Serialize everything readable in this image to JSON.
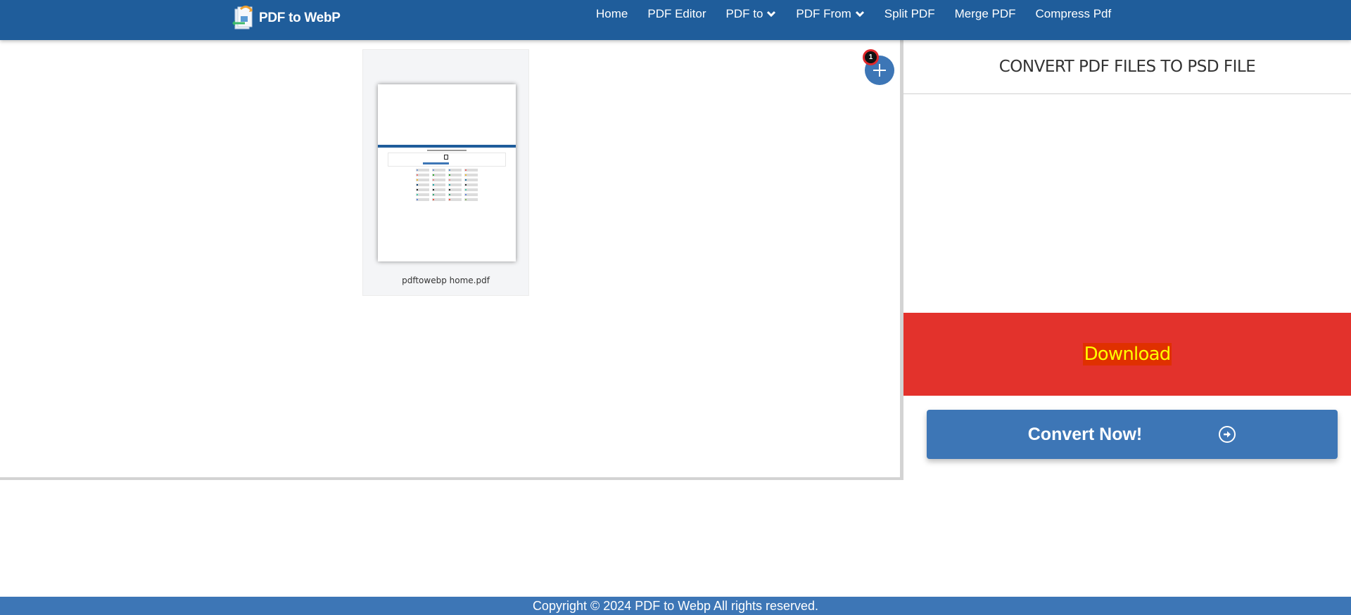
{
  "header": {
    "logo_text": "PDF to WebP",
    "nav": [
      {
        "label": "Home",
        "dropdown": false
      },
      {
        "label": "PDF Editor",
        "dropdown": false
      },
      {
        "label": "PDF to",
        "dropdown": true
      },
      {
        "label": "PDF From",
        "dropdown": true
      },
      {
        "label": "Split PDF",
        "dropdown": false
      },
      {
        "label": "Merge PDF",
        "dropdown": false
      },
      {
        "label": "Compress Pdf",
        "dropdown": false
      }
    ]
  },
  "files": {
    "count_badge": "1",
    "add_icon": "plus-icon",
    "items": [
      {
        "name": "pdftowebp home.pdf"
      }
    ]
  },
  "panel": {
    "title": "CONVERT PDF FILES TO PSD FILE",
    "download_label": "Download",
    "convert_label": "Convert Now!",
    "convert_icon": "arrow-circle-right-icon"
  },
  "footer": {
    "copyright": "Copyright © 2024 PDF to Webp All rights reserved."
  },
  "colors": {
    "header_bg": "#1f5d9b",
    "accent": "#3d76b6",
    "download_bg": "#e3322c",
    "download_text": "#ffff00",
    "badge_border": "#e0282b"
  }
}
